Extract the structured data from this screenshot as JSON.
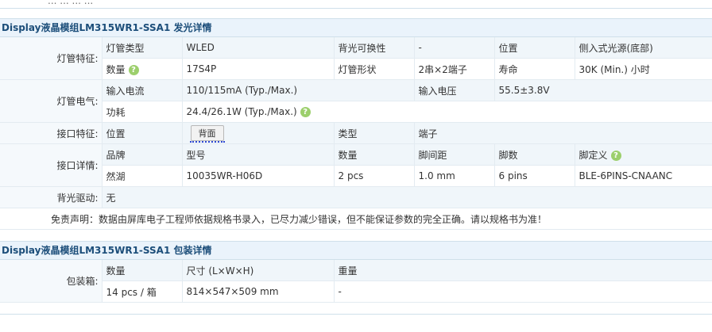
{
  "top_fragment": "... ... ... ...",
  "section1": {
    "title": "Display液晶模组LM315WR1-SSA1 发光详情",
    "lamp_features": {
      "label": "灯管特征:",
      "lamp_type_label": "灯管类型",
      "lamp_type": "WLED",
      "replaceable_label": "背光可换性",
      "replaceable": "-",
      "position_label": "位置",
      "position": "侧入式光源(底部)",
      "count_label": "数量",
      "count": "17S4P",
      "shape_label": "灯管形状",
      "shape": "2串×2端子",
      "life_label": "寿命",
      "life": "30K (Min.) 小时"
    },
    "lamp_electrical": {
      "label": "灯管电气:",
      "current_label": "输入电流",
      "current": "110/115mA (Typ./Max.)",
      "voltage_label": "输入电压",
      "voltage": "55.5±3.8V",
      "power_label": "功耗",
      "power": "24.4/26.1W (Typ./Max.)"
    },
    "interface_features": {
      "label": "接口特征:",
      "position_label": "位置",
      "position_button": "背面",
      "type_label": "类型",
      "type": "端子"
    },
    "interface_details": {
      "label": "接口详情:",
      "headers": [
        "品牌",
        "型号",
        "数量",
        "脚间距",
        "脚数",
        "脚定义"
      ],
      "row": [
        "然湖",
        "10035WR-H06D",
        "2 pcs",
        "1.0 mm",
        "6 pins",
        "BLE-6PINS-CNAANC"
      ]
    },
    "backlight_driver": {
      "label": "背光驱动:",
      "value": "无"
    },
    "disclaimer": "免责声明：数据由屏库电子工程师依据规格书录入，已尽力减少错误，但不能保证参数的完全正确。请以规格书为准！"
  },
  "section2": {
    "title": "Display液晶模组LM315WR1-SSA1 包装详情",
    "packaging": {
      "label": "包装箱:",
      "headers": [
        "数量",
        "尺寸 (L×W×H)",
        "重量"
      ],
      "row": [
        "14 pcs / 箱",
        "814×547×509 mm",
        "-"
      ]
    }
  },
  "colors": {
    "section_title_bg": "#eaf3fb",
    "section_title_text": "#1c4e7a",
    "help_icon": "#9ccf6c"
  }
}
